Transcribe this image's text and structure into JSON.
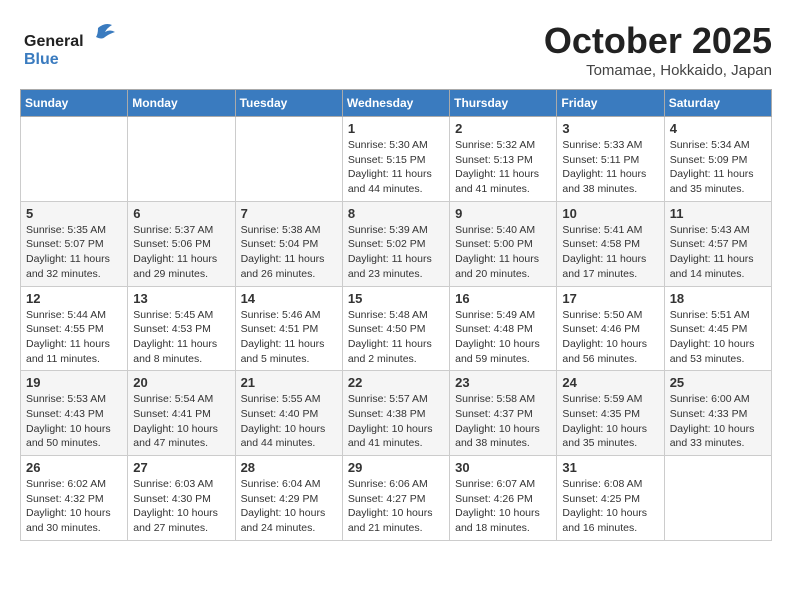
{
  "header": {
    "logo_line1": "General",
    "logo_line2": "Blue",
    "month": "October 2025",
    "location": "Tomamae, Hokkaido, Japan"
  },
  "columns": [
    "Sunday",
    "Monday",
    "Tuesday",
    "Wednesday",
    "Thursday",
    "Friday",
    "Saturday"
  ],
  "weeks": [
    {
      "days": [
        {
          "num": "",
          "info": ""
        },
        {
          "num": "",
          "info": ""
        },
        {
          "num": "",
          "info": ""
        },
        {
          "num": "1",
          "info": "Sunrise: 5:30 AM\nSunset: 5:15 PM\nDaylight: 11 hours\nand 44 minutes."
        },
        {
          "num": "2",
          "info": "Sunrise: 5:32 AM\nSunset: 5:13 PM\nDaylight: 11 hours\nand 41 minutes."
        },
        {
          "num": "3",
          "info": "Sunrise: 5:33 AM\nSunset: 5:11 PM\nDaylight: 11 hours\nand 38 minutes."
        },
        {
          "num": "4",
          "info": "Sunrise: 5:34 AM\nSunset: 5:09 PM\nDaylight: 11 hours\nand 35 minutes."
        }
      ]
    },
    {
      "days": [
        {
          "num": "5",
          "info": "Sunrise: 5:35 AM\nSunset: 5:07 PM\nDaylight: 11 hours\nand 32 minutes."
        },
        {
          "num": "6",
          "info": "Sunrise: 5:37 AM\nSunset: 5:06 PM\nDaylight: 11 hours\nand 29 minutes."
        },
        {
          "num": "7",
          "info": "Sunrise: 5:38 AM\nSunset: 5:04 PM\nDaylight: 11 hours\nand 26 minutes."
        },
        {
          "num": "8",
          "info": "Sunrise: 5:39 AM\nSunset: 5:02 PM\nDaylight: 11 hours\nand 23 minutes."
        },
        {
          "num": "9",
          "info": "Sunrise: 5:40 AM\nSunset: 5:00 PM\nDaylight: 11 hours\nand 20 minutes."
        },
        {
          "num": "10",
          "info": "Sunrise: 5:41 AM\nSunset: 4:58 PM\nDaylight: 11 hours\nand 17 minutes."
        },
        {
          "num": "11",
          "info": "Sunrise: 5:43 AM\nSunset: 4:57 PM\nDaylight: 11 hours\nand 14 minutes."
        }
      ]
    },
    {
      "days": [
        {
          "num": "12",
          "info": "Sunrise: 5:44 AM\nSunset: 4:55 PM\nDaylight: 11 hours\nand 11 minutes."
        },
        {
          "num": "13",
          "info": "Sunrise: 5:45 AM\nSunset: 4:53 PM\nDaylight: 11 hours\nand 8 minutes."
        },
        {
          "num": "14",
          "info": "Sunrise: 5:46 AM\nSunset: 4:51 PM\nDaylight: 11 hours\nand 5 minutes."
        },
        {
          "num": "15",
          "info": "Sunrise: 5:48 AM\nSunset: 4:50 PM\nDaylight: 11 hours\nand 2 minutes."
        },
        {
          "num": "16",
          "info": "Sunrise: 5:49 AM\nSunset: 4:48 PM\nDaylight: 10 hours\nand 59 minutes."
        },
        {
          "num": "17",
          "info": "Sunrise: 5:50 AM\nSunset: 4:46 PM\nDaylight: 10 hours\nand 56 minutes."
        },
        {
          "num": "18",
          "info": "Sunrise: 5:51 AM\nSunset: 4:45 PM\nDaylight: 10 hours\nand 53 minutes."
        }
      ]
    },
    {
      "days": [
        {
          "num": "19",
          "info": "Sunrise: 5:53 AM\nSunset: 4:43 PM\nDaylight: 10 hours\nand 50 minutes."
        },
        {
          "num": "20",
          "info": "Sunrise: 5:54 AM\nSunset: 4:41 PM\nDaylight: 10 hours\nand 47 minutes."
        },
        {
          "num": "21",
          "info": "Sunrise: 5:55 AM\nSunset: 4:40 PM\nDaylight: 10 hours\nand 44 minutes."
        },
        {
          "num": "22",
          "info": "Sunrise: 5:57 AM\nSunset: 4:38 PM\nDaylight: 10 hours\nand 41 minutes."
        },
        {
          "num": "23",
          "info": "Sunrise: 5:58 AM\nSunset: 4:37 PM\nDaylight: 10 hours\nand 38 minutes."
        },
        {
          "num": "24",
          "info": "Sunrise: 5:59 AM\nSunset: 4:35 PM\nDaylight: 10 hours\nand 35 minutes."
        },
        {
          "num": "25",
          "info": "Sunrise: 6:00 AM\nSunset: 4:33 PM\nDaylight: 10 hours\nand 33 minutes."
        }
      ]
    },
    {
      "days": [
        {
          "num": "26",
          "info": "Sunrise: 6:02 AM\nSunset: 4:32 PM\nDaylight: 10 hours\nand 30 minutes."
        },
        {
          "num": "27",
          "info": "Sunrise: 6:03 AM\nSunset: 4:30 PM\nDaylight: 10 hours\nand 27 minutes."
        },
        {
          "num": "28",
          "info": "Sunrise: 6:04 AM\nSunset: 4:29 PM\nDaylight: 10 hours\nand 24 minutes."
        },
        {
          "num": "29",
          "info": "Sunrise: 6:06 AM\nSunset: 4:27 PM\nDaylight: 10 hours\nand 21 minutes."
        },
        {
          "num": "30",
          "info": "Sunrise: 6:07 AM\nSunset: 4:26 PM\nDaylight: 10 hours\nand 18 minutes."
        },
        {
          "num": "31",
          "info": "Sunrise: 6:08 AM\nSunset: 4:25 PM\nDaylight: 10 hours\nand 16 minutes."
        },
        {
          "num": "",
          "info": ""
        }
      ]
    }
  ]
}
